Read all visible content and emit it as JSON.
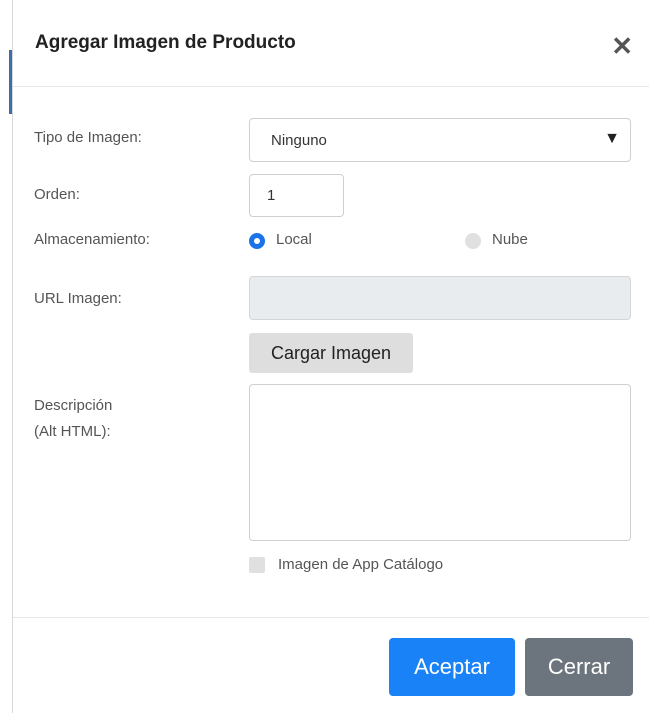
{
  "modal": {
    "title": "Agregar Imagen de Producto",
    "close_glyph": "✕"
  },
  "form": {
    "type_label": "Tipo de Imagen:",
    "type_value": "Ninguno",
    "type_caret": "▼",
    "order_label": "Orden:",
    "order_value": "1",
    "storage_label": "Almacenamiento:",
    "storage_options": [
      {
        "label": "Local",
        "checked": true
      },
      {
        "label": "Nube",
        "checked": false
      }
    ],
    "url_label": "URL Imagen:",
    "url_value": "",
    "upload_button": "Cargar Imagen",
    "description_label_line1": "Descripción",
    "description_label_line2": "(Alt HTML):",
    "description_value": "",
    "catalog_checkbox_label": "Imagen de App Catálogo",
    "catalog_checked": false
  },
  "footer": {
    "accept_button": "Aceptar",
    "close_button": "Cerrar"
  },
  "colors": {
    "primary": "#1a82f7",
    "secondary": "#6c757d",
    "radio_checked": "#1a73e8"
  }
}
